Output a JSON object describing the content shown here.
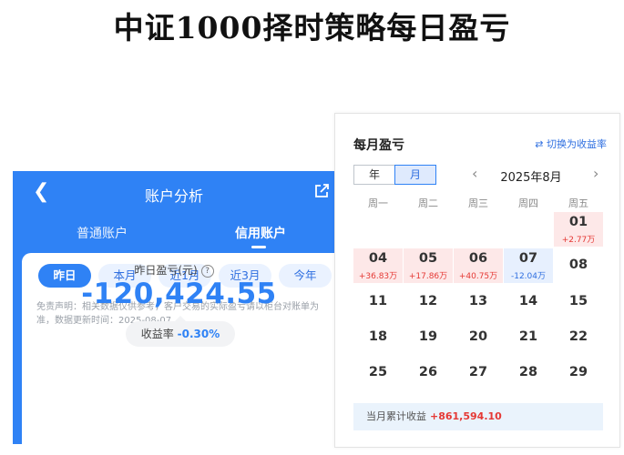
{
  "headline": "中证1000择时策略每日盈亏",
  "phone": {
    "title": "账户分析",
    "account_tabs": [
      "普通账户",
      "信用账户"
    ],
    "periods": [
      "昨日",
      "本月",
      "近1月",
      "近3月",
      "今年"
    ],
    "disclaimer": "免责声明：相关数据仅供参考，客户交易的实际盈亏请以柜台对账单为准，数据更新时间：2025-08-07",
    "pnl_label": "昨日盈亏(元)",
    "pnl_value": "-120,424.55",
    "return_label": "收益率",
    "return_value": "-0.30%"
  },
  "calendar": {
    "title": "每月盈亏",
    "switch_label": "⇄ 切换为收益率",
    "year_tab": "年",
    "month_tab": "月",
    "month_label": "2025年8月",
    "weekdays": [
      "周一",
      "周二",
      "周三",
      "周四",
      "周五"
    ],
    "days": [
      {
        "d": "01",
        "pnl": "+2.77万",
        "kind": "gain"
      },
      {
        "d": "04",
        "pnl": "+36.83万",
        "kind": "gain"
      },
      {
        "d": "05",
        "pnl": "+17.86万",
        "kind": "gain"
      },
      {
        "d": "06",
        "pnl": "+40.75万",
        "kind": "gain"
      },
      {
        "d": "07",
        "pnl": "-12.04万",
        "kind": "loss"
      },
      {
        "d": "08",
        "pnl": "",
        "kind": ""
      },
      {
        "d": "11",
        "pnl": "",
        "kind": ""
      },
      {
        "d": "12",
        "pnl": "",
        "kind": ""
      },
      {
        "d": "13",
        "pnl": "",
        "kind": ""
      },
      {
        "d": "14",
        "pnl": "",
        "kind": ""
      },
      {
        "d": "15",
        "pnl": "",
        "kind": ""
      },
      {
        "d": "18",
        "pnl": "",
        "kind": ""
      },
      {
        "d": "19",
        "pnl": "",
        "kind": ""
      },
      {
        "d": "20",
        "pnl": "",
        "kind": ""
      },
      {
        "d": "21",
        "pnl": "",
        "kind": ""
      },
      {
        "d": "22",
        "pnl": "",
        "kind": ""
      },
      {
        "d": "25",
        "pnl": "",
        "kind": ""
      },
      {
        "d": "26",
        "pnl": "",
        "kind": ""
      },
      {
        "d": "27",
        "pnl": "",
        "kind": ""
      },
      {
        "d": "28",
        "pnl": "",
        "kind": ""
      },
      {
        "d": "29",
        "pnl": "",
        "kind": ""
      }
    ],
    "total_label": "当月累计收益",
    "total_value": "+861,594.10"
  },
  "colors": {
    "accent": "#2f82f5",
    "gain": "#e53935",
    "gain_bg": "#fde8e8",
    "loss_bg": "#e7f0fe"
  },
  "icons": [
    "back-arrow-icon",
    "share-icon",
    "help-icon",
    "swap-icon",
    "chevron-left-icon",
    "chevron-right-icon"
  ]
}
